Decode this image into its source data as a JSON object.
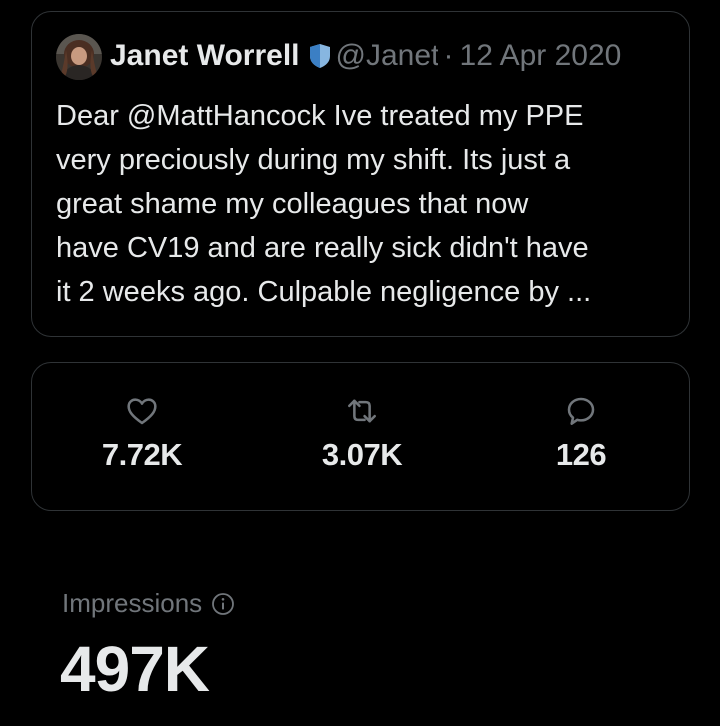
{
  "tweet": {
    "author_name": "Janet Worrell",
    "handle": "@Janet",
    "separator": "·",
    "date": "12 Apr 2020",
    "text": "Dear @MattHancock Ive treated my PPE\nvery preciously during my shift. Its just a\ngreat shame my colleagues that now\nhave CV19 and are really sick didn't have\nit 2 weeks ago. Culpable negligence by ..."
  },
  "stats": {
    "likes": {
      "icon": "heart-icon",
      "value": "7.72K"
    },
    "retweets": {
      "icon": "retweet-icon",
      "value": "3.07K"
    },
    "replies": {
      "icon": "reply-icon",
      "value": "126"
    }
  },
  "impressions": {
    "label": "Impressions",
    "icon": "info-icon",
    "value": "497K"
  },
  "colors": {
    "background": "#000000",
    "text_primary": "#e7e9ea",
    "text_secondary": "#71767b",
    "border": "#2f3336",
    "verified_badge": "#87b6e0"
  }
}
